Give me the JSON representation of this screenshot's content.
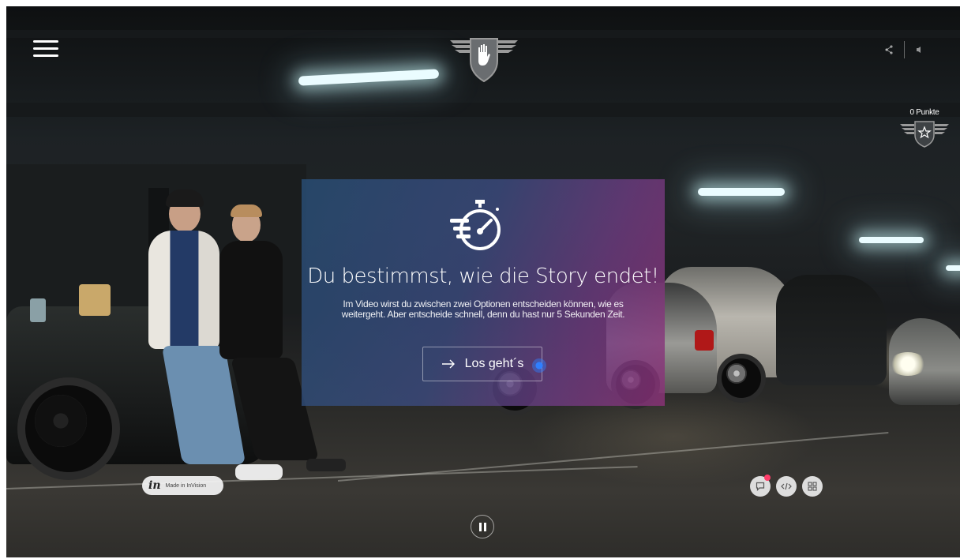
{
  "brand": {
    "logo_icon": "hand-shield-logo-icon"
  },
  "header": {
    "menu_icon": "hamburger-menu-icon",
    "share_icon": "share-icon",
    "sound_icon": "speaker-icon"
  },
  "score": {
    "label": "0 Punkte",
    "icon": "star-badge-icon"
  },
  "modal": {
    "icon": "stopwatch-speed-icon",
    "title": "Du bestimmst, wie die Story endet!",
    "description": "Im Video wirst du zwischen zwei Optionen entscheiden können, wie es weitergeht. Aber entscheide schnell, denn du hast nur 5 Sekunden Zeit.",
    "cta_label": "Los geht´s",
    "cta_icon": "arrow-right-icon"
  },
  "invision_badge": {
    "logo": "in",
    "label": "Made in InVision"
  },
  "toolbar": {
    "comment_icon": "comment-icon",
    "code_icon": "code-icon",
    "grid_icon": "grid-icon"
  },
  "player": {
    "pause_icon": "pause-icon"
  },
  "colors": {
    "modal_gradient_start": "#284e76",
    "modal_gradient_end": "#8c3278",
    "notification": "#ff3d6a",
    "cursor": "#2f7fff"
  }
}
